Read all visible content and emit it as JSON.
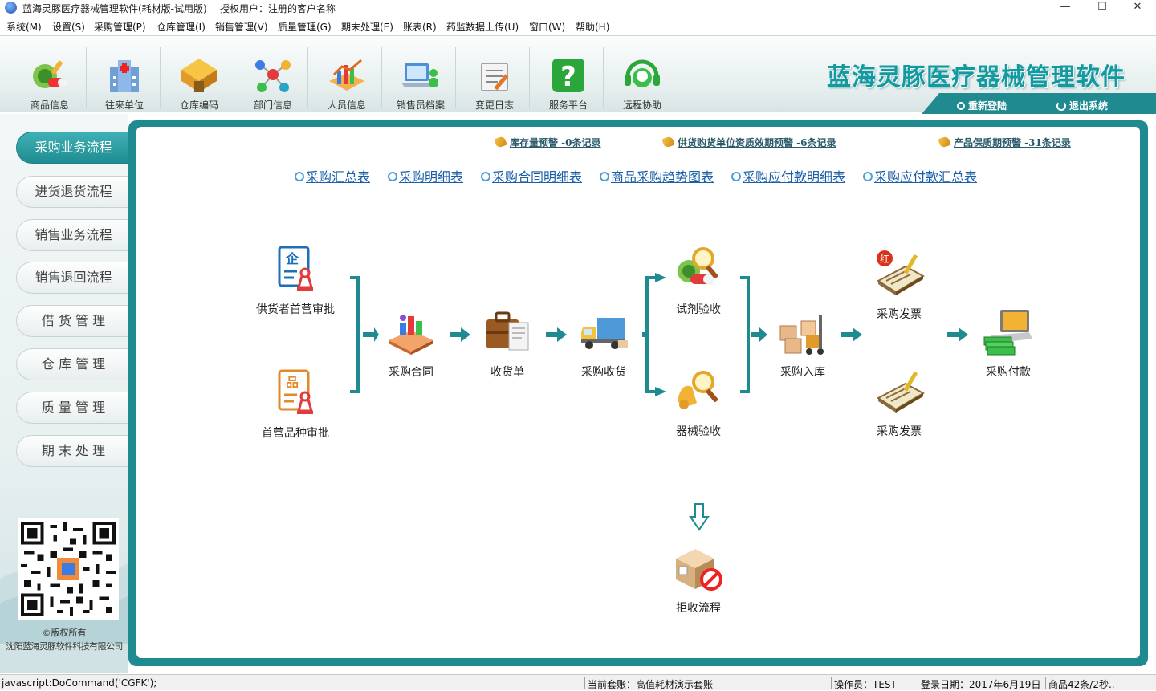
{
  "window": {
    "title": "蓝海灵豚医疗器械管理软件(耗材版-试用版)",
    "license": "授权用户：注册的客户名称",
    "minimize_glyph": "—",
    "maximize_glyph": "☐",
    "close_glyph": "✕"
  },
  "menu": [
    {
      "label": "系统(M)"
    },
    {
      "label": "设置(S)"
    },
    {
      "label": "采购管理(P)"
    },
    {
      "label": "仓库管理(I)"
    },
    {
      "label": "销售管理(V)"
    },
    {
      "label": "质量管理(G)"
    },
    {
      "label": "期末处理(E)"
    },
    {
      "label": "账表(R)"
    },
    {
      "label": "药监数据上传(U)"
    },
    {
      "label": "窗口(W)"
    },
    {
      "label": "帮助(H)"
    }
  ],
  "toolbar": {
    "buttons": [
      {
        "label": "商品信息",
        "icon": "pill-icon"
      },
      {
        "label": "往来单位",
        "icon": "hospital-icon"
      },
      {
        "label": "仓库编码",
        "icon": "warehouse-icon"
      },
      {
        "label": "部门信息",
        "icon": "network-icon"
      },
      {
        "label": "人员信息",
        "icon": "chart-icon"
      },
      {
        "label": "销售员档案",
        "icon": "laptop-users-icon"
      },
      {
        "label": "变更日志",
        "icon": "log-icon"
      },
      {
        "label": "服务平台",
        "icon": "help-icon"
      },
      {
        "label": "远程协助",
        "icon": "headset-icon"
      }
    ],
    "brand": "蓝海灵豚医疗器械管理软件",
    "relogin": "重新登陆",
    "exit": "退出系统"
  },
  "sidebar": {
    "items": [
      {
        "label": "采购业务流程",
        "active": true
      },
      {
        "label": "进货退货流程",
        "active": false
      },
      {
        "label": "销售业务流程",
        "active": false
      },
      {
        "label": "销售退回流程",
        "active": false
      },
      {
        "label": "借 货 管 理",
        "active": false
      },
      {
        "label": "仓 库 管 理",
        "active": false
      },
      {
        "label": "质 量 管 理",
        "active": false
      },
      {
        "label": "期 末 处 理",
        "active": false
      }
    ],
    "copyright_line1": "©版权所有",
    "copyright_line2": "沈阳蓝海灵豚软件科技有限公司"
  },
  "warnings": [
    {
      "label": "库存量预警 -0条记录"
    },
    {
      "label": "供货购货单位资质效期预警 -6条记录"
    },
    {
      "label": "产品保质期预警 -31条记录"
    }
  ],
  "reports": [
    {
      "label": "采购汇总表"
    },
    {
      "label": "采购明细表"
    },
    {
      "label": "采购合同明细表"
    },
    {
      "label": "商品采购趋势图表"
    },
    {
      "label": "采购应付款明细表"
    },
    {
      "label": "采购应付款汇总表"
    }
  ],
  "flow": {
    "supplier_approval": "供货者首营审批",
    "product_approval": "首营品种审批",
    "contract": "采购合同",
    "receipt": "收货单",
    "receiving": "采购收货",
    "reagent_check": "试剂验收",
    "device_check": "器械验收",
    "stock_in": "采购入库",
    "invoice_red": "采购发票",
    "invoice_red_badge": "红",
    "invoice": "采购发票",
    "payment": "采购付款",
    "reject": "拒收流程",
    "supplier_badge": "企",
    "product_badge": "品"
  },
  "status": {
    "left": "javascript:DoCommand('CGFK');",
    "account": "当前套账：高值耗材演示套账",
    "operator": "操作员：TEST",
    "login_date": "登录日期：2017年6月19日",
    "products": "商品42条/2秒.."
  },
  "colors": {
    "accent": "#1f8a90",
    "link": "#1a5fa8",
    "arrow": "#1f8a90"
  }
}
